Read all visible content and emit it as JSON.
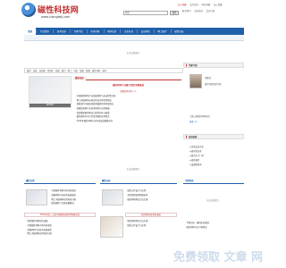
{
  "header": {
    "logo_title": "磁性科技网",
    "logo_url": "www.cixingkeji.com",
    "search_placeholder": "搜索",
    "search_button": "搜索",
    "top_links": [
      "加入收藏",
      "设为首页",
      "网站地图",
      "加入收藏"
    ],
    "sub_links": [
      "联系我们",
      "会员登录",
      "会员注册"
    ]
  },
  "nav": {
    "items": [
      "首页",
      "行业资讯",
      "技术文章",
      "专家介绍",
      "市场分析",
      "供求信息",
      "企业名录",
      "会员风采",
      "网上展厅",
      "磁性论坛"
    ]
  },
  "banner": {
    "text1": "无法加载图片。",
    "text2": "无法加载图片。"
  },
  "tags": [
    "磁材",
    "永磁",
    "钕铁硼",
    "铁氧体",
    "软磁",
    "磁芯",
    "稀土",
    "电机",
    "磁粉",
    "磁钢",
    "磁性材料",
    "磁环"
  ],
  "left_pic": {
    "caption": "磁性材料"
  },
  "news": {
    "tab": "最新动态",
    "headline": "磁性材料产业重大项目专题报道",
    "headline_sub": "查看更多资讯 >>",
    "items": [
      "中国磁性材料产业发展现状与未来趋势分析",
      "稀土永磁材料价格走势及市场供需报告",
      "新能源汽车驱动电机用磁材需求持续增长",
      "软磁铁氧体行业技术创新与应用拓展",
      "钕铁硼永磁材料出口形势分析与展望",
      "磁性器件在电子信息领域的应用研究",
      "2016年磁性材料行业年度盛会圆满召开"
    ]
  },
  "sidebar": {
    "expert_head": "专家介绍",
    "expert_name": "张教授",
    "expert_desc": "磁学领域资深专家",
    "expert_desc2": "主要从事磁性材料研究",
    "more": "更多 >>",
    "list_head": "会员信息",
    "list": [
      "优质会员企业",
      "磁材供应商",
      "磁芯生产厂家",
      "磁性器件",
      "设备制造商"
    ]
  },
  "sections": {
    "sec1": "磁性文章",
    "sec2": "磁性分析",
    "sec3": "专家风采"
  },
  "bottom": {
    "red_bar_left": "2016年第二十届中国国际磁性材料展览会",
    "red_bar_mid": "磁性材料技术新进展",
    "left_items": [
      "中国磁性材料市场分析报告",
      "软磁材料行业技术发展报告",
      "稀土永磁材料应用前景分析",
      "磁性器件产业链发展概况",
      "新型磁性材料研究进展"
    ],
    "mid_items": [
      "磁性元件设计与应用",
      "高性能永磁体制备技术",
      "磁性材料测试方法汇编"
    ],
    "right_items": [
      "专家访谈：磁材未来发展",
      "磁性材料行业人物风采"
    ],
    "nodata": "无法加载图片。"
  },
  "watermark": "免费领取 文章 网"
}
